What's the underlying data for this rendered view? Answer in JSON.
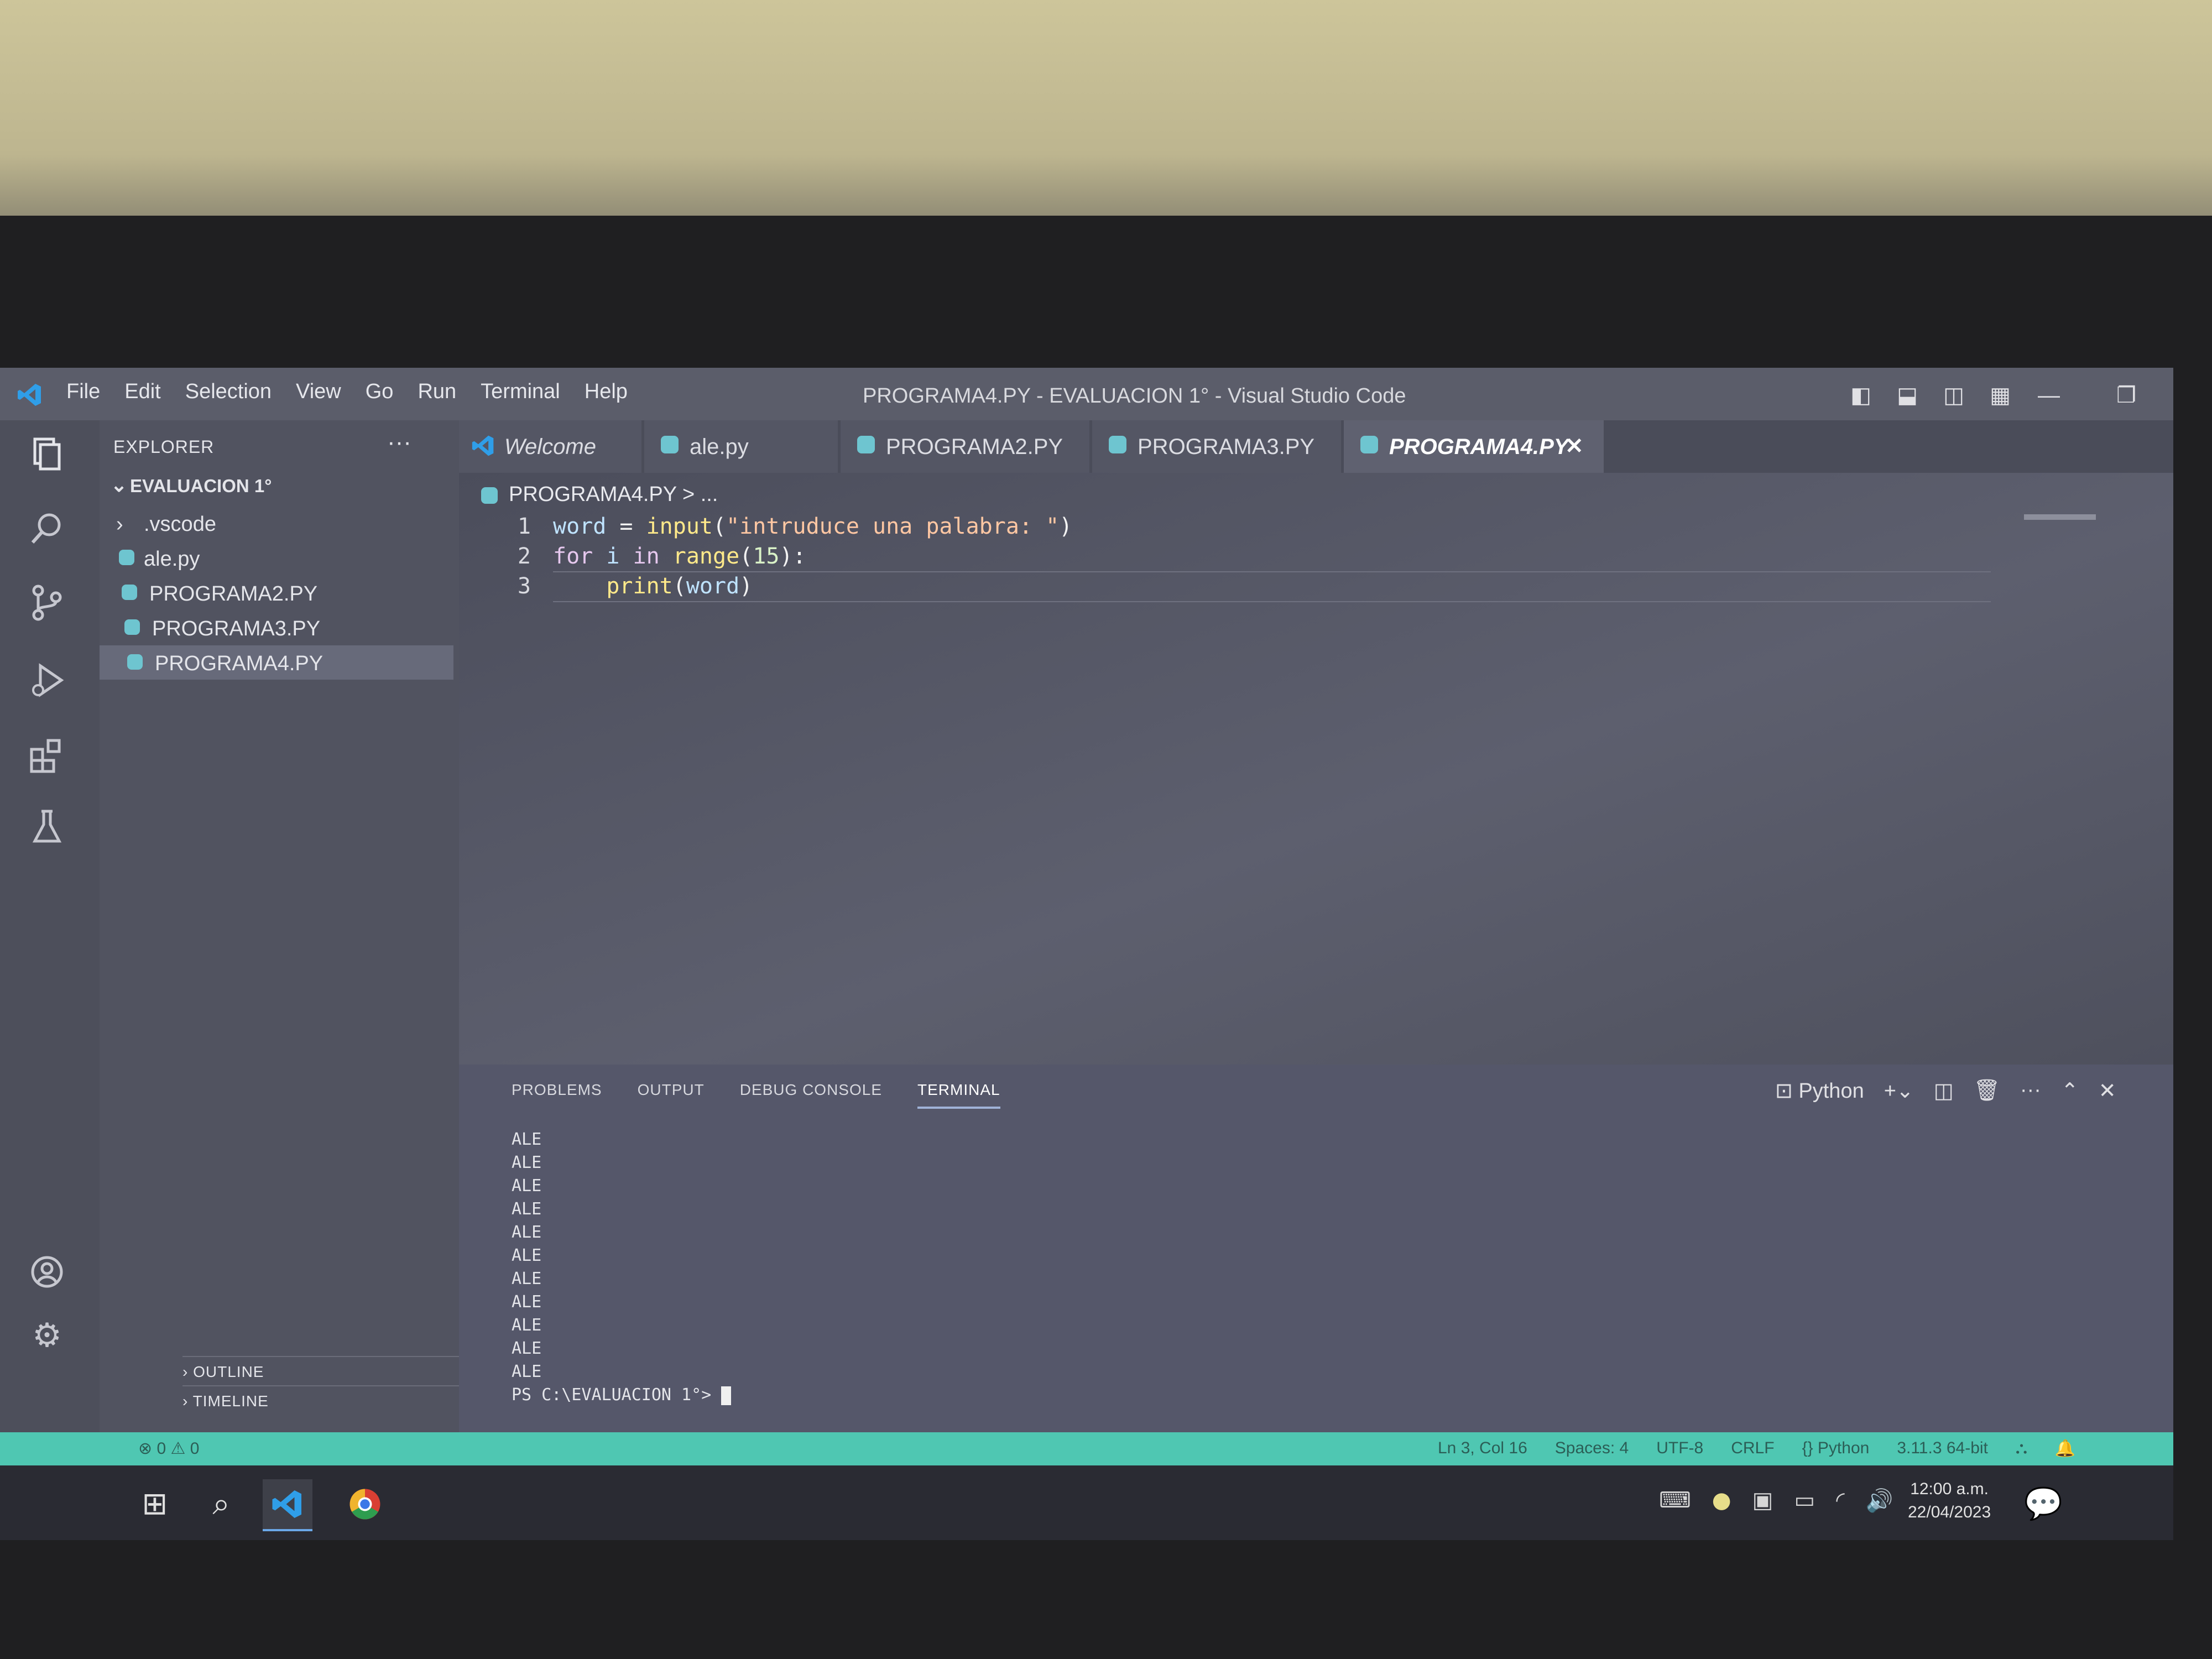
{
  "window": {
    "title": "PROGRAMA4.PY - EVALUACION 1° - Visual Studio Code"
  },
  "menu": [
    "File",
    "Edit",
    "Selection",
    "View",
    "Go",
    "Run",
    "Terminal",
    "Help"
  ],
  "sidebar": {
    "title": "EXPLORER",
    "more": "···",
    "folder": "EVALUACION 1°",
    "items": [
      ".vscode",
      "ale.py",
      "PROGRAMA2.PY",
      "PROGRAMA3.PY",
      "PROGRAMA4.PY"
    ],
    "outline": "OUTLINE",
    "timeline": "TIMELINE"
  },
  "tabs": [
    "Welcome",
    "ale.py",
    "PROGRAMA2.PY",
    "PROGRAMA3.PY",
    "PROGRAMA4.PY"
  ],
  "breadcrumb": "PROGRAMA4.PY > ...",
  "code": {
    "line_numbers": [
      "1",
      "2",
      "3"
    ],
    "l1": [
      "word",
      " = ",
      "input",
      "(",
      "\"intruduce una palabra: \"",
      ")"
    ],
    "l2": [
      "for",
      " i ",
      "in",
      " ",
      "range",
      "(",
      "15",
      "):"
    ],
    "l3": [
      "    ",
      "print",
      "(",
      "word",
      ")"
    ]
  },
  "panel": {
    "tabs": [
      "PROBLEMS",
      "OUTPUT",
      "DEBUG CONSOLE",
      "TERMINAL"
    ],
    "active_tab": "TERMINAL",
    "shell": "Python",
    "terminal_lines": [
      "ALE",
      "ALE",
      "ALE",
      "ALE",
      "ALE",
      "ALE",
      "ALE",
      "ALE",
      "ALE",
      "ALE",
      "ALE"
    ],
    "prompt": "PS C:\\EVALUACION 1°>"
  },
  "status": {
    "problems": "⊗ 0 ⚠ 0",
    "position": "Ln 3, Col 16",
    "spaces": "Spaces: 4",
    "encoding": "UTF-8",
    "eol": "CRLF",
    "language": "{} Python",
    "interpreter": "3.11.3 64-bit"
  },
  "taskbar": {
    "time": "12:00 a.m.",
    "date": "22/04/2023"
  },
  "colors": {
    "statusbar": "#4fc7b2",
    "python_icon": "#6ec5d0",
    "vscode_blue": "#2f9ee8"
  }
}
